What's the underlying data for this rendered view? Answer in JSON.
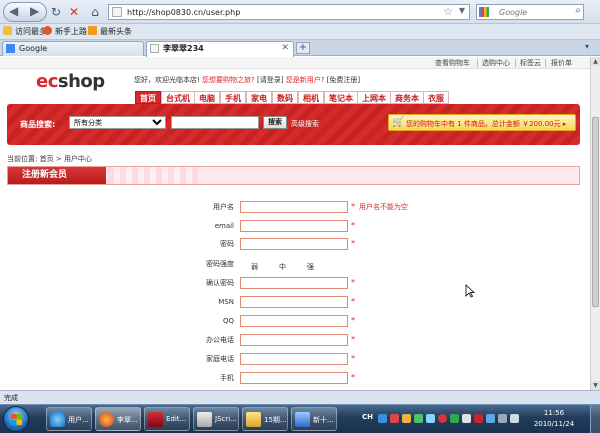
{
  "browser": {
    "url": "http://shop0830.cn/user.php",
    "search_placeholder": "Google",
    "bookmarks": [
      "访问最多",
      "新手上路",
      "最新头条"
    ],
    "tabs": [
      {
        "label": "Google"
      },
      {
        "label": "李翠翠234"
      }
    ],
    "status_text": "完成"
  },
  "page": {
    "top_links": [
      "查看购物车",
      "选购中心",
      "标签云",
      "报价单"
    ],
    "logo": {
      "left": "ec",
      "right": "shop"
    },
    "welcome": {
      "greeting": "您好，欢迎光临本店!",
      "p1": "您想要购物之旅?",
      "login": "[请登录]",
      "p2": "您是新用户?",
      "register": "[免费注册]"
    },
    "categories": [
      "首页",
      "台式机",
      "电脑",
      "手机",
      "家电",
      "数码",
      "相机",
      "笔记本",
      "上网本",
      "商务本",
      "衣服"
    ],
    "search": {
      "label": "商品搜索:",
      "category_default": "所有分类",
      "button": "搜索",
      "advanced": "高级搜索"
    },
    "cart_text": "您的购物车中有 1 件商品，总计金额 ￥200.00元 ▸",
    "breadcrumb": {
      "prefix": "当前位置:",
      "home": "首页",
      "sep": ">",
      "current": "用户中心"
    },
    "register_title": "注册新会员",
    "form": {
      "fields": [
        {
          "label": "用户名",
          "required": true,
          "error": "用户名不能为空"
        },
        {
          "label": "email",
          "required": true,
          "error": ""
        },
        {
          "label": "密码",
          "required": true,
          "error": ""
        },
        {
          "label": "确认密码",
          "required": true,
          "error": ""
        },
        {
          "label": "MSN",
          "required": true,
          "error": ""
        },
        {
          "label": "QQ",
          "required": true,
          "error": ""
        },
        {
          "label": "办公电话",
          "required": true,
          "error": ""
        },
        {
          "label": "家庭电话",
          "required": true,
          "error": ""
        },
        {
          "label": "手机",
          "required": true,
          "error": ""
        }
      ],
      "strength_label": "密码强度",
      "strength_levels": [
        "弱",
        "中",
        "强"
      ],
      "required_mark": "*"
    }
  },
  "taskbar": {
    "buttons": [
      "用户...",
      "李翠...",
      "Edit...",
      "JScri...",
      "15期...",
      "新十..."
    ],
    "lang": "CH",
    "time": "11:56",
    "date": "2010/11/24"
  }
}
